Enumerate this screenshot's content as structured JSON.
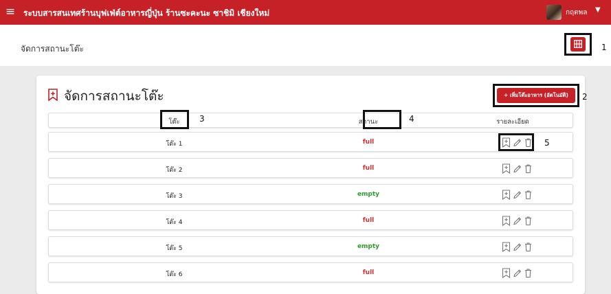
{
  "topbar": {
    "title": "ระบบสารสนเทศร้านบุฟเฟ่ต์อาหารญี่ปุ่น ร้านซะคะนะ ซาชิมิ เชียงใหม่",
    "username": "กฤตพล",
    "menu_icon": "hamburger-icon",
    "caret_icon": "caret-down-icon"
  },
  "breadcrumb": "จัดการสถานะโต๊ะ",
  "grid_button_icon": "grid-icon",
  "card": {
    "title": "จัดการสถานะโต๊ะ",
    "title_icon": "bookmark-plus-icon",
    "add_button": "+ เพิ่มโต๊ะอาหาร (อัตโนมัติ)"
  },
  "table": {
    "headers": {
      "table": "โต๊ะ",
      "status": "สถานะ",
      "detail": "รายละเอียด"
    },
    "rows": [
      {
        "table": "โต๊ะ 1",
        "status": "full"
      },
      {
        "table": "โต๊ะ 2",
        "status": "full"
      },
      {
        "table": "โต๊ะ 3",
        "status": "empty"
      },
      {
        "table": "โต๊ะ 4",
        "status": "full"
      },
      {
        "table": "โต๊ะ 5",
        "status": "empty"
      },
      {
        "table": "โต๊ะ 6",
        "status": "full"
      }
    ],
    "action_icons": [
      "bookmark-plus-icon",
      "pencil-icon",
      "trash-icon"
    ]
  },
  "annotations": [
    "1",
    "2",
    "3",
    "4",
    "5"
  ],
  "colors": {
    "brand": "#c62127",
    "full": "#d32f2f",
    "empty": "#2e9b2e",
    "background": "#ebebeb"
  }
}
